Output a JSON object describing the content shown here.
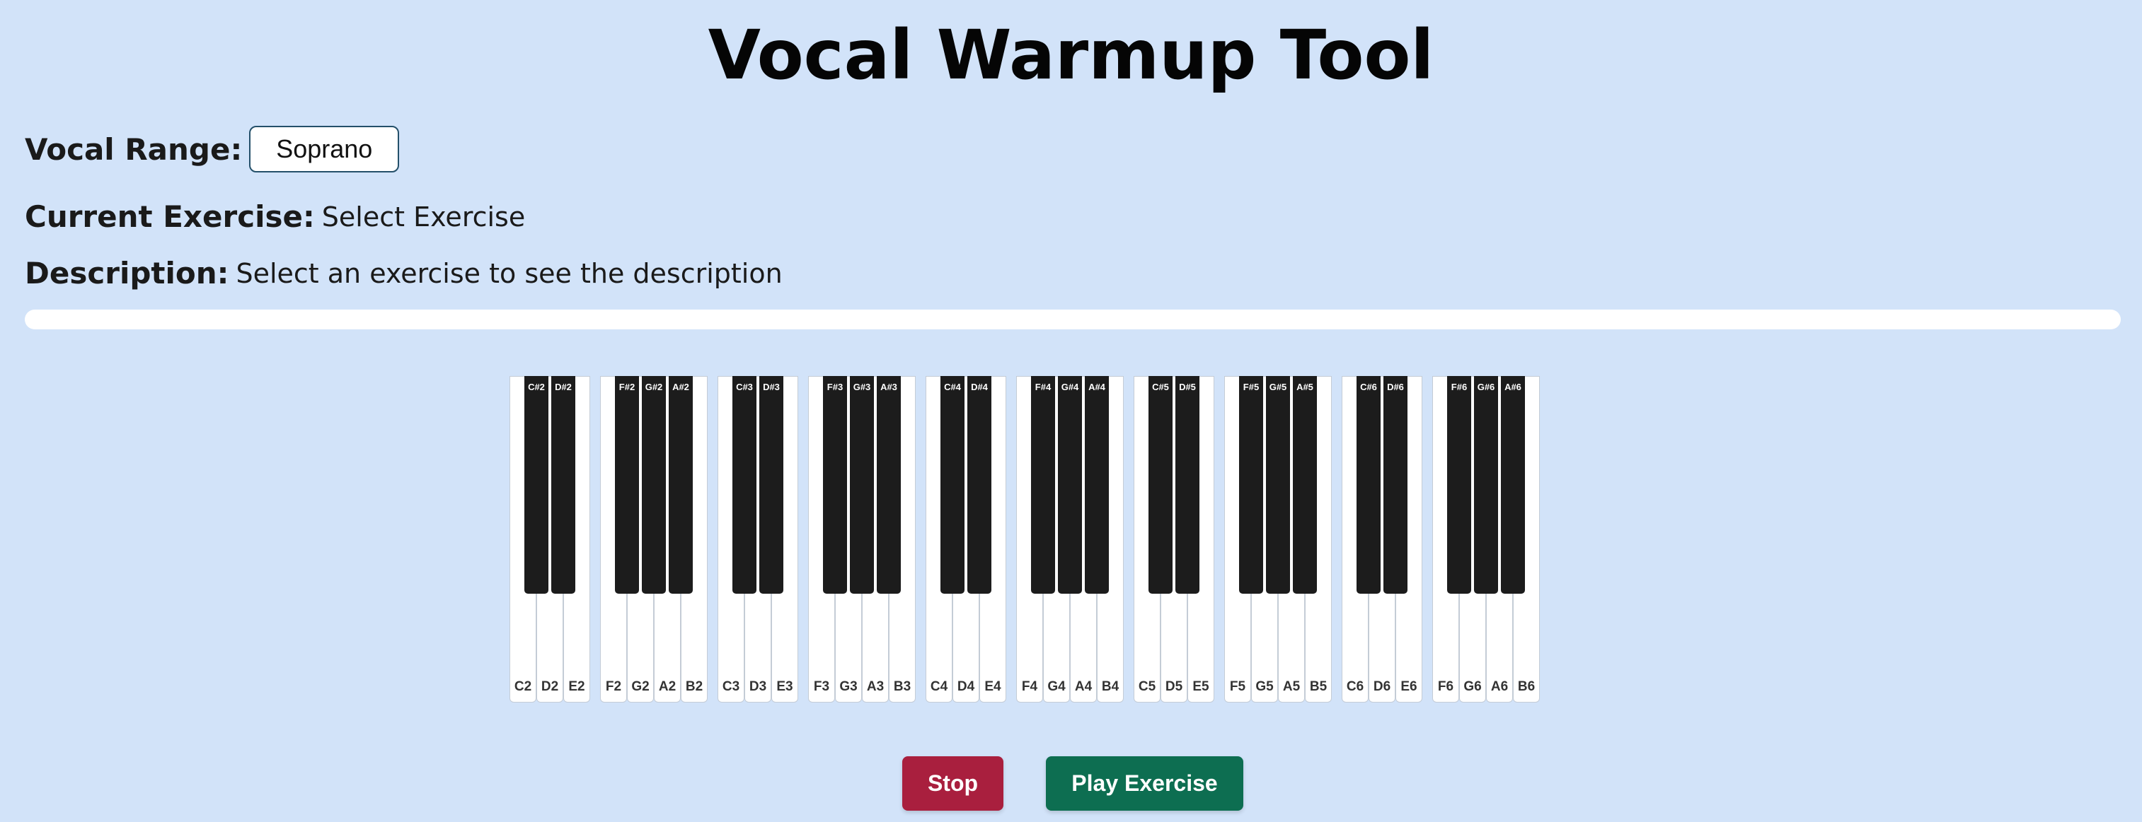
{
  "title": "Vocal Warmup Tool",
  "vocal_range": {
    "label": "Vocal Range:",
    "selected": "Soprano"
  },
  "current_exercise": {
    "label": "Current Exercise:",
    "value": "Select Exercise"
  },
  "description": {
    "label": "Description:",
    "value": "Select an exercise to see the description"
  },
  "progress": {
    "percent": 0
  },
  "piano": {
    "octaves": [
      {
        "white": [
          "C2",
          "D2",
          "E2"
        ],
        "black": [
          "C#2",
          "D#2"
        ]
      },
      {
        "white": [
          "F2",
          "G2",
          "A2",
          "B2"
        ],
        "black": [
          "F#2",
          "G#2",
          "A#2"
        ]
      },
      {
        "white": [
          "C3",
          "D3",
          "E3"
        ],
        "black": [
          "C#3",
          "D#3"
        ]
      },
      {
        "white": [
          "F3",
          "G3",
          "A3",
          "B3"
        ],
        "black": [
          "F#3",
          "G#3",
          "A#3"
        ]
      },
      {
        "white": [
          "C4",
          "D4",
          "E4"
        ],
        "black": [
          "C#4",
          "D#4"
        ]
      },
      {
        "white": [
          "F4",
          "G4",
          "A4",
          "B4"
        ],
        "black": [
          "F#4",
          "G#4",
          "A#4"
        ]
      },
      {
        "white": [
          "C5",
          "D5",
          "E5"
        ],
        "black": [
          "C#5",
          "D#5"
        ]
      },
      {
        "white": [
          "F5",
          "G5",
          "A5",
          "B5"
        ],
        "black": [
          "F#5",
          "G#5",
          "A#5"
        ]
      },
      {
        "white": [
          "C6",
          "D6",
          "E6"
        ],
        "black": [
          "C#6",
          "D#6"
        ]
      },
      {
        "white": [
          "F6",
          "G6",
          "A6",
          "B6"
        ],
        "black": [
          "F#6",
          "G#6",
          "A#6"
        ]
      }
    ]
  },
  "buttons": {
    "stop": "Stop",
    "play": "Play Exercise"
  },
  "colors": {
    "background": "#d2e3f9",
    "stop_button": "#a91f3e",
    "play_button": "#0d6e51",
    "black_key": "#1c1c1c",
    "white_key": "#ffffff"
  }
}
